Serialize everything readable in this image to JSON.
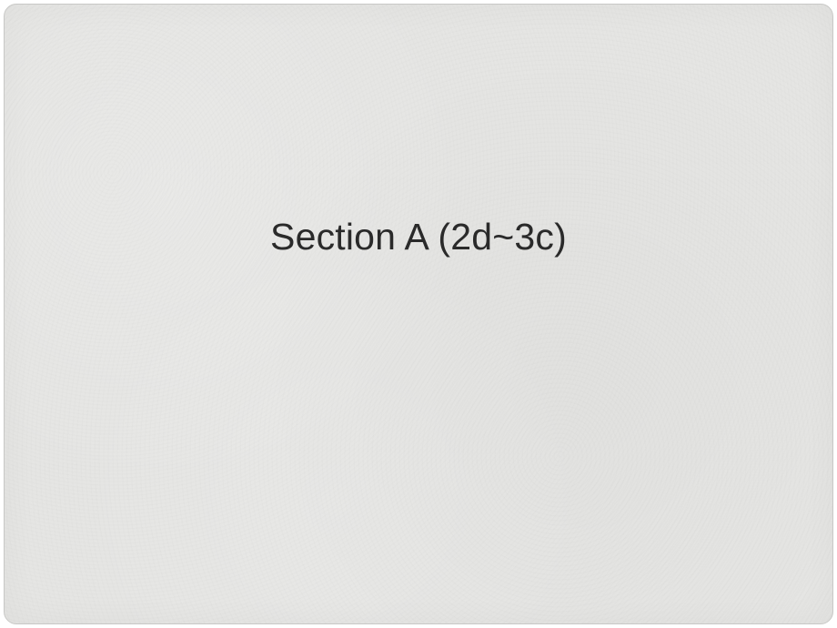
{
  "slide": {
    "title": "Section A (2d~3c)"
  }
}
